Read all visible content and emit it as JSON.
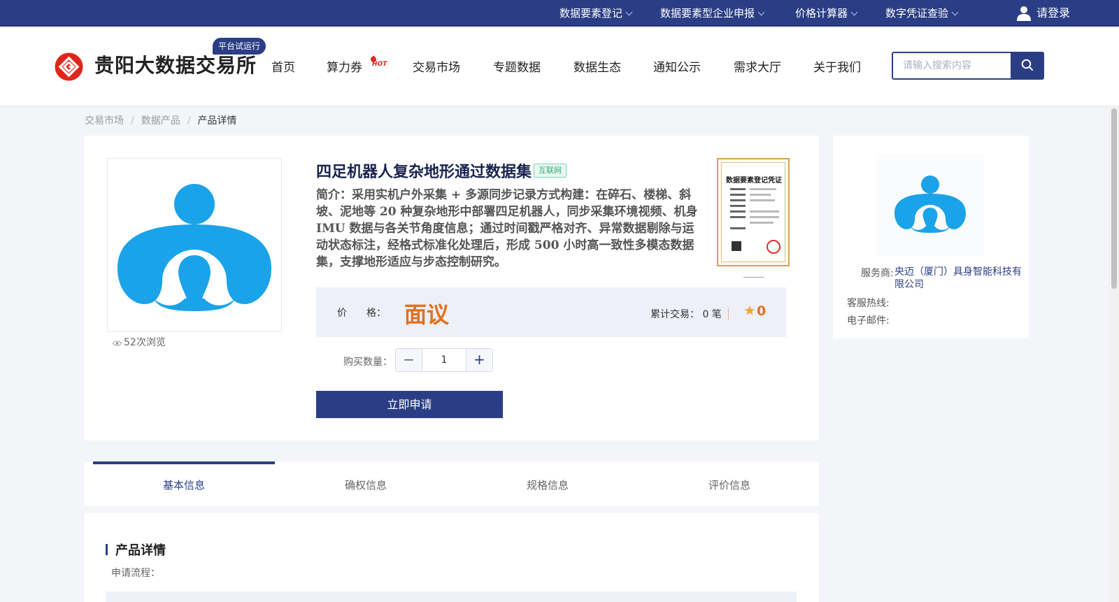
{
  "topbar": {
    "links": [
      {
        "label": "数据要素登记"
      },
      {
        "label": "数据要素型企业申报"
      },
      {
        "label": "价格计算器"
      },
      {
        "label": "数字凭证查验"
      }
    ],
    "login_label": "请登录"
  },
  "header": {
    "logo_text": "贵阳大数据交易所",
    "trial_badge": "平台试运行",
    "nav": [
      {
        "label": "首页"
      },
      {
        "label": "算力券"
      },
      {
        "label": "交易市场"
      },
      {
        "label": "专题数据"
      },
      {
        "label": "数据生态"
      },
      {
        "label": "通知公示"
      },
      {
        "label": "需求大厅"
      },
      {
        "label": "关于我们"
      }
    ],
    "hot_badge": "HOT",
    "search_placeholder": "请输入搜索内容"
  },
  "breadcrumb": {
    "items": [
      "交易市场",
      "数据产品",
      "产品详情"
    ],
    "separator": "/"
  },
  "product": {
    "views": "52次浏览",
    "title": "四足机器人复杂地形通过数据集",
    "tag": "互联网",
    "description": "简介：采用实机户外采集 + 多源同步记录方式构建：在碎石、楼梯、斜坡、泥地等 20 种复杂地形中部署四足机器人，同步采集环境视频、机身 IMU 数据与各关节角度信息；通过时间戳严格对齐、异常数据剔除与运动状态标注，经格式标准化处理后，形成 500 小时高一致性多模态数据集，支撑地形适应与步态控制研究。",
    "certificate_title": "数据要素登记凭证",
    "price_label": "价　　格：",
    "price_value": "面议",
    "trade_count": "累计交易： 0 笔",
    "rating": "0",
    "quantity_label": "购买数量：",
    "quantity": "1",
    "minus_symbol": "−",
    "plus_symbol": "+",
    "apply_label": "立即申请"
  },
  "provider": {
    "name_label": "服务商:",
    "name": "央迈（厦门）具身智能科技有限公司",
    "hotline_label": "客服热线:",
    "hotline": "",
    "email_label": "电子邮件:",
    "email": ""
  },
  "tabs": [
    {
      "label": "基本信息",
      "active": true
    },
    {
      "label": "确权信息",
      "active": false
    },
    {
      "label": "规格信息",
      "active": false
    },
    {
      "label": "评价信息",
      "active": false
    }
  ],
  "detail": {
    "title": "产品详情",
    "apply_flow_label": "申请流程："
  },
  "colors": {
    "brand": "#2b3e85",
    "price": "#e4701e",
    "logo_red": "#e0261a",
    "logo_blue": "#1aa3e8",
    "tag_green": "#2aa877"
  },
  "icons": {
    "user": "user-icon",
    "search": "search-icon",
    "eye": "eye-icon",
    "star": "star-icon",
    "chevron": "chevron-down-icon"
  }
}
